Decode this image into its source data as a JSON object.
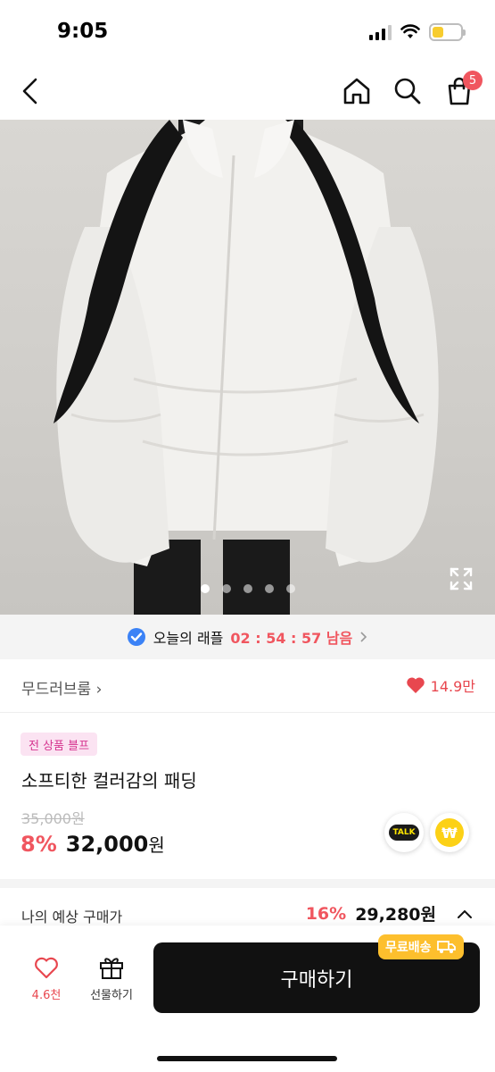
{
  "status_bar": {
    "time": "9:05"
  },
  "nav": {
    "cart_count": "5"
  },
  "carousel": {
    "total": 5,
    "active_index": 0
  },
  "raffle": {
    "label": "오늘의 래플",
    "countdown": "02 : 54 : 57 남음"
  },
  "seller": {
    "name": "무드러브룸 ›",
    "likes": "14.9만"
  },
  "product": {
    "badge": "전 상품 블프",
    "title": "소프티한 컬러감의 패딩",
    "original_price": "35,000원",
    "discount": "8%",
    "price": "32,000",
    "price_unit": "원"
  },
  "share": {
    "talk_label": "TALK",
    "pay_symbol": "₩"
  },
  "expected": {
    "label": "나의 예상 구매가",
    "discount": "16%",
    "price": "29,280원"
  },
  "bottom_bar": {
    "wish_count": "4.6천",
    "gift_label": "선물하기",
    "buy_label": "구매하기",
    "shipping_label": "무료배송"
  },
  "colors": {
    "accent": "#f0565f",
    "badge_bg": "#fbe3f2",
    "badge_text": "#d6338f",
    "shipping": "#fdbf2d",
    "buy_button": "#111111"
  }
}
